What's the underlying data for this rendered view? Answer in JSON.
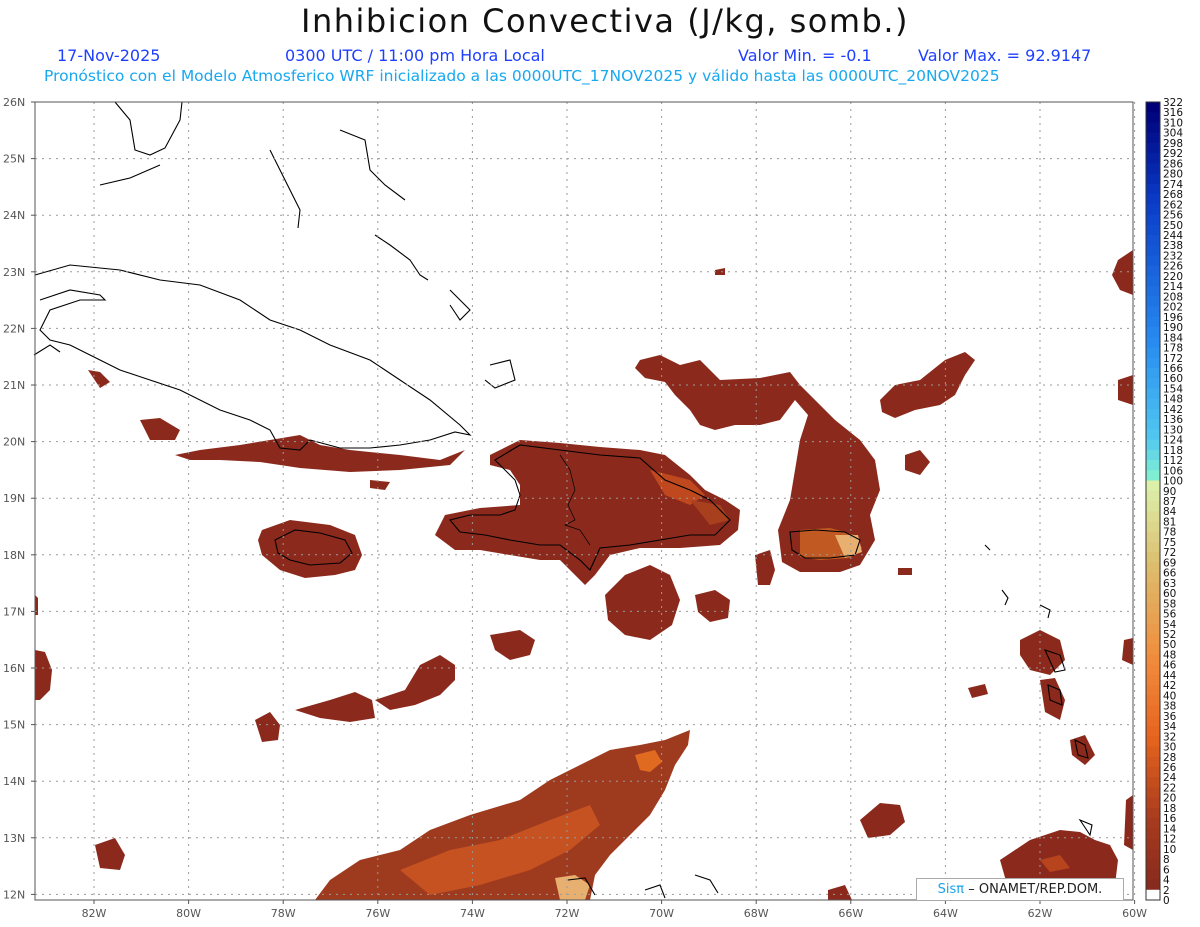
{
  "header": {
    "title": "Inhibicion Convectiva (J/kg, somb.)",
    "date": "17-Nov-2025",
    "time": "0300 UTC / 11:00 pm Hora Local",
    "valor_min": "Valor Min. = -0.1",
    "valor_max": "Valor Max. = 92.9147",
    "subtitle": "Pronóstico con el Modelo Atmosferico WRF inicializado a las 0000UTC_17NOV2025 y válido hasta las  0000UTC_20NOV2025"
  },
  "map": {
    "lat_labels": [
      "26N",
      "25N",
      "24N",
      "23N",
      "22N",
      "21N",
      "20N",
      "19N",
      "18N",
      "17N",
      "16N",
      "15N",
      "14N",
      "13N",
      "12N"
    ],
    "lon_labels": [
      "82W",
      "80W",
      "78W",
      "76W",
      "74W",
      "72W",
      "70W",
      "68W",
      "66W",
      "64W",
      "62W",
      "60W"
    ],
    "shade_colors": {
      "low": "#8b2a1c",
      "mid": "#b8441e",
      "high": "#e06a20",
      "peak": "#eab070"
    },
    "coast_color": "#000000"
  },
  "colorbar": {
    "labels": [
      "322",
      "316",
      "310",
      "304",
      "298",
      "292",
      "286",
      "280",
      "274",
      "268",
      "262",
      "256",
      "250",
      "244",
      "238",
      "232",
      "226",
      "220",
      "214",
      "208",
      "202",
      "196",
      "190",
      "184",
      "178",
      "172",
      "166",
      "160",
      "154",
      "148",
      "142",
      "136",
      "130",
      "124",
      "118",
      "112",
      "106",
      "100",
      "90",
      "87",
      "84",
      "81",
      "78",
      "75",
      "72",
      "69",
      "66",
      "63",
      "60",
      "58",
      "56",
      "54",
      "52",
      "50",
      "48",
      "46",
      "44",
      "42",
      "40",
      "38",
      "36",
      "34",
      "32",
      "30",
      "28",
      "26",
      "24",
      "22",
      "20",
      "18",
      "16",
      "14",
      "12",
      "10",
      "8",
      "6",
      "4",
      "2",
      "0"
    ]
  },
  "credit": {
    "sis": "Sisπ",
    "text": "– ONAMET/REP.DOM."
  }
}
